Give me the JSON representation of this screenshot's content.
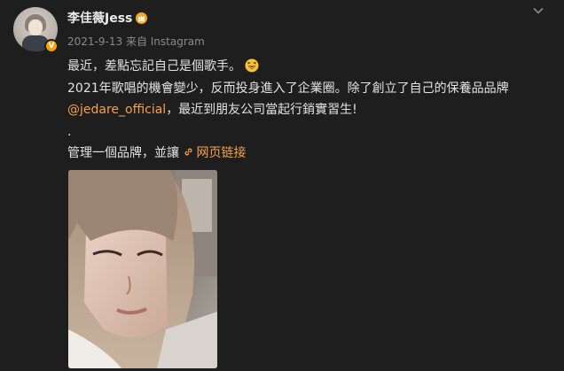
{
  "user": {
    "name": "李佳薇Jess",
    "verified_badge": "V"
  },
  "meta": {
    "date": "2021-9-13",
    "source": "来自 Instagram"
  },
  "post": {
    "line1": "最近，差點忘記自己是個歌手。",
    "line2": "2021年歌唱的機會變少，反而投身進入了企業圈。除了創立了自己的保養品品牌",
    "mention": "@jedare_official",
    "line3_rest": "，最近到朋友公司當起行銷實習生!",
    "line4": ".",
    "line5": "管理一個品牌，並讓",
    "link_label": "网页链接"
  },
  "icons": {
    "crown": "crown-badge-icon",
    "chevron": "chevron-down-icon",
    "emoji": "laughing-emoji-icon",
    "link": "link-icon"
  },
  "colors": {
    "background": "#1e1e1e",
    "accent": "#f5a14c",
    "verified": "#f8a10f",
    "muted": "#8a8a8a"
  }
}
